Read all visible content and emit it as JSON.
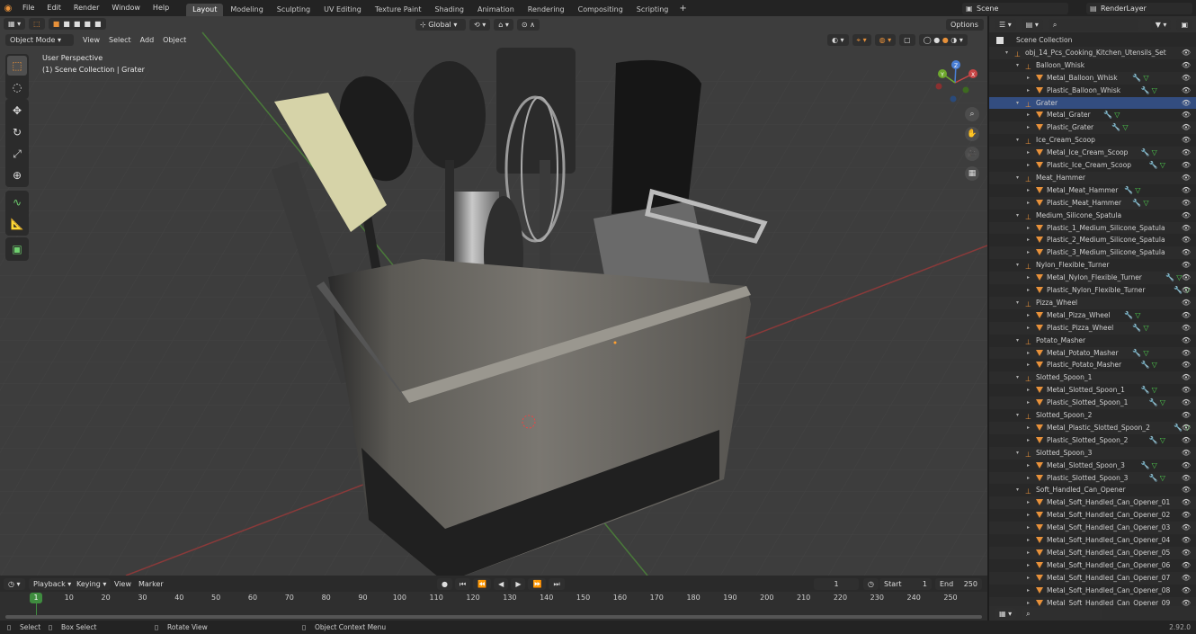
{
  "top_menu": [
    "File",
    "Edit",
    "Render",
    "Window",
    "Help"
  ],
  "workspace_tabs": [
    "Layout",
    "Modeling",
    "Sculpting",
    "UV Editing",
    "Texture Paint",
    "Shading",
    "Animation",
    "Rendering",
    "Compositing",
    "Scripting"
  ],
  "active_tab": "Layout",
  "scene_field": "Scene",
  "render_layer_field": "RenderLayer",
  "viewport": {
    "mode": "Object Mode",
    "menus": [
      "View",
      "Select",
      "Add",
      "Object"
    ],
    "transform_orientation": "Global",
    "options_label": "Options",
    "overlay_title": "User Perspective",
    "overlay_subtitle": "(1) Scene Collection | Grater",
    "gizmo": {
      "x": "X",
      "y": "Y",
      "z": "Z"
    }
  },
  "outliner": {
    "root": "Scene Collection",
    "rows": [
      {
        "label": "obj_14_Pcs_Cooking_Kitchen_Utensils_Set",
        "level": 1,
        "type": "empty"
      },
      {
        "label": "Balloon_Whisk",
        "level": 2,
        "type": "empty"
      },
      {
        "label": "Metal_Balloon_Whisk",
        "level": 3,
        "type": "mesh"
      },
      {
        "label": "Plastic_Balloon_Whisk",
        "level": 3,
        "type": "mesh"
      },
      {
        "label": "Grater",
        "level": 2,
        "type": "empty",
        "selected": true
      },
      {
        "label": "Metal_Grater",
        "level": 3,
        "type": "mesh"
      },
      {
        "label": "Plastic_Grater",
        "level": 3,
        "type": "mesh"
      },
      {
        "label": "Ice_Cream_Scoop",
        "level": 2,
        "type": "empty"
      },
      {
        "label": "Metal_Ice_Cream_Scoop",
        "level": 3,
        "type": "mesh"
      },
      {
        "label": "Plastic_Ice_Cream_Scoop",
        "level": 3,
        "type": "mesh"
      },
      {
        "label": "Meat_Hammer",
        "level": 2,
        "type": "empty"
      },
      {
        "label": "Metal_Meat_Hammer",
        "level": 3,
        "type": "mesh"
      },
      {
        "label": "Plastic_Meat_Hammer",
        "level": 3,
        "type": "mesh"
      },
      {
        "label": "Medium_Silicone_Spatula",
        "level": 2,
        "type": "empty"
      },
      {
        "label": "Plastic_1_Medium_Silicone_Spatula",
        "level": 3,
        "type": "mesh"
      },
      {
        "label": "Plastic_2_Medium_Silicone_Spatula",
        "level": 3,
        "type": "mesh"
      },
      {
        "label": "Plastic_3_Medium_Silicone_Spatula",
        "level": 3,
        "type": "mesh"
      },
      {
        "label": "Nylon_Flexible_Turner",
        "level": 2,
        "type": "empty"
      },
      {
        "label": "Metal_Nylon_Flexible_Turner",
        "level": 3,
        "type": "mesh"
      },
      {
        "label": "Plastic_Nylon_Flexible_Turner",
        "level": 3,
        "type": "mesh"
      },
      {
        "label": "Pizza_Wheel",
        "level": 2,
        "type": "empty"
      },
      {
        "label": "Metal_Pizza_Wheel",
        "level": 3,
        "type": "mesh"
      },
      {
        "label": "Plastic_Pizza_Wheel",
        "level": 3,
        "type": "mesh"
      },
      {
        "label": "Potato_Masher",
        "level": 2,
        "type": "empty"
      },
      {
        "label": "Metal_Potato_Masher",
        "level": 3,
        "type": "mesh"
      },
      {
        "label": "Plastic_Potato_Masher",
        "level": 3,
        "type": "mesh"
      },
      {
        "label": "Slotted_Spoon_1",
        "level": 2,
        "type": "empty"
      },
      {
        "label": "Metal_Slotted_Spoon_1",
        "level": 3,
        "type": "mesh"
      },
      {
        "label": "Plastic_Slotted_Spoon_1",
        "level": 3,
        "type": "mesh"
      },
      {
        "label": "Slotted_Spoon_2",
        "level": 2,
        "type": "empty"
      },
      {
        "label": "Metal_Plastic_Slotted_Spoon_2",
        "level": 3,
        "type": "mesh"
      },
      {
        "label": "Plastic_Slotted_Spoon_2",
        "level": 3,
        "type": "mesh"
      },
      {
        "label": "Slotted_Spoon_3",
        "level": 2,
        "type": "empty"
      },
      {
        "label": "Metal_Slotted_Spoon_3",
        "level": 3,
        "type": "mesh"
      },
      {
        "label": "Plastic_Slotted_Spoon_3",
        "level": 3,
        "type": "mesh"
      },
      {
        "label": "Soft_Handled_Can_Opener",
        "level": 2,
        "type": "empty"
      },
      {
        "label": "Metal_Soft_Handled_Can_Opener_01",
        "level": 3,
        "type": "mesh"
      },
      {
        "label": "Metal_Soft_Handled_Can_Opener_02",
        "level": 3,
        "type": "mesh"
      },
      {
        "label": "Metal_Soft_Handled_Can_Opener_03",
        "level": 3,
        "type": "mesh"
      },
      {
        "label": "Metal_Soft_Handled_Can_Opener_04",
        "level": 3,
        "type": "mesh"
      },
      {
        "label": "Metal_Soft_Handled_Can_Opener_05",
        "level": 3,
        "type": "mesh"
      },
      {
        "label": "Metal_Soft_Handled_Can_Opener_06",
        "level": 3,
        "type": "mesh"
      },
      {
        "label": "Metal_Soft_Handled_Can_Opener_07",
        "level": 3,
        "type": "mesh"
      },
      {
        "label": "Metal_Soft_Handled_Can_Opener_08",
        "level": 3,
        "type": "mesh"
      },
      {
        "label": "Metal_Soft_Handled_Can_Opener_09",
        "level": 3,
        "type": "mesh"
      }
    ]
  },
  "timeline": {
    "menus": [
      "Playback",
      "Keying",
      "View",
      "Marker"
    ],
    "current_frame": "1",
    "start_label": "Start",
    "start": "1",
    "end_label": "End",
    "end": "250",
    "frame_marks": [
      "1",
      "10",
      "20",
      "30",
      "40",
      "50",
      "60",
      "70",
      "80",
      "90",
      "100",
      "110",
      "120",
      "130",
      "140",
      "150",
      "160",
      "170",
      "180",
      "190",
      "200",
      "210",
      "220",
      "230",
      "240",
      "250"
    ]
  },
  "statusbar": {
    "select": "Select",
    "box_select": "Box Select",
    "rotate_view": "Rotate View",
    "context_menu": "Object Context Menu",
    "version": "2.92.0"
  },
  "colors": {
    "accent_selected": "#334d80",
    "active_tool": "#e8913a",
    "x_axis": "#c84545",
    "y_axis": "#6ea82d",
    "z_axis": "#4a7fd6"
  }
}
